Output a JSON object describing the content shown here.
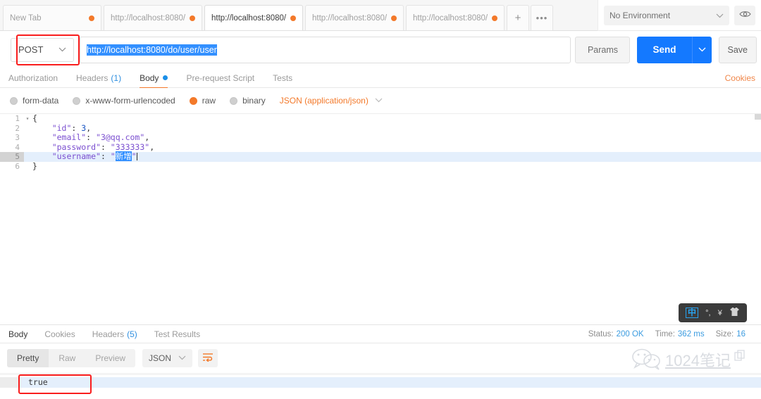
{
  "tabs": {
    "items": [
      {
        "label": "New Tab",
        "active": false,
        "unsaved": true
      },
      {
        "label": "http://localhost:8080/",
        "active": false,
        "unsaved": true
      },
      {
        "label": "http://localhost:8080/",
        "active": true,
        "unsaved": true
      },
      {
        "label": "http://localhost:8080/",
        "active": false,
        "unsaved": true
      },
      {
        "label": "http://localhost:8080/",
        "active": false,
        "unsaved": true
      }
    ],
    "new_tab_icon": "plus-icon",
    "more_icon": "ellipsis-icon"
  },
  "environment": {
    "selected": "No Environment",
    "chevron": "⌄",
    "eye_icon": "eye-icon"
  },
  "request": {
    "method": "POST",
    "method_chevron": "⌄",
    "url": "http://localhost:8080/do/user/user",
    "params_label": "Params",
    "send_label": "Send",
    "send_chevron": "⌄",
    "save_label": "Save"
  },
  "request_tabs": {
    "items": [
      {
        "label": "Authorization",
        "active": false,
        "count": "",
        "dot": false
      },
      {
        "label": "Headers",
        "active": false,
        "count": "(1)",
        "dot": false
      },
      {
        "label": "Body",
        "active": true,
        "count": "",
        "dot": true
      },
      {
        "label": "Pre-request Script",
        "active": false,
        "count": "",
        "dot": false
      },
      {
        "label": "Tests",
        "active": false,
        "count": "",
        "dot": false
      }
    ],
    "cookies_link": "Cookies"
  },
  "body_types": {
    "options": [
      {
        "label": "form-data",
        "selected": false
      },
      {
        "label": "x-www-form-urlencoded",
        "selected": false
      },
      {
        "label": "raw",
        "selected": true
      },
      {
        "label": "binary",
        "selected": false
      }
    ],
    "content_type": "JSON (application/json)",
    "chevron": "⌄"
  },
  "editor": {
    "lines": [
      {
        "num": "1",
        "fold": "▾",
        "text": "{",
        "highlight": false
      },
      {
        "num": "2",
        "fold": "",
        "text": "    \"id\": 3,",
        "highlight": false
      },
      {
        "num": "3",
        "fold": "",
        "text": "    \"email\": \"3@qq.com\",",
        "highlight": false
      },
      {
        "num": "4",
        "fold": "",
        "text": "    \"password\": \"333333\",",
        "highlight": false
      },
      {
        "num": "5",
        "fold": "",
        "text": "    \"username\": \"新增\"",
        "highlight": true
      },
      {
        "num": "6",
        "fold": "",
        "text": "}",
        "highlight": false
      }
    ],
    "json": {
      "id": 3,
      "email": "3@qq.com",
      "password": "333333",
      "username": "新增"
    },
    "selected_text": "新增"
  },
  "ime": {
    "mode": "中",
    "punctuation": "°,",
    "currency": "¥",
    "skin_icon": "shirt-icon"
  },
  "response_tabs": {
    "items": [
      {
        "label": "Body",
        "active": true,
        "count": ""
      },
      {
        "label": "Cookies",
        "active": false,
        "count": ""
      },
      {
        "label": "Headers",
        "active": false,
        "count": "(5)"
      },
      {
        "label": "Test Results",
        "active": false,
        "count": ""
      }
    ],
    "status_label": "Status:",
    "status_value": "200 OK",
    "time_label": "Time:",
    "time_value": "362 ms",
    "size_label": "Size:",
    "size_value": "16"
  },
  "response_view": {
    "modes": [
      {
        "label": "Pretty",
        "selected": true
      },
      {
        "label": "Raw",
        "selected": false
      },
      {
        "label": "Preview",
        "selected": false
      }
    ],
    "format": "JSON",
    "format_chevron": "⌄",
    "wrap_icon": "wrap-lines-icon"
  },
  "response_body": {
    "text": "true"
  },
  "watermark": {
    "logo_icon": "wechat-icon",
    "text": "1024笔记",
    "copy_icon": "copy-icon"
  },
  "colors": {
    "accent_orange": "#f3792a",
    "send_blue": "#1479ff",
    "status_blue": "#3c9ce0",
    "annotation_red": "#f91d1d",
    "selection_blue": "#3390ff"
  }
}
